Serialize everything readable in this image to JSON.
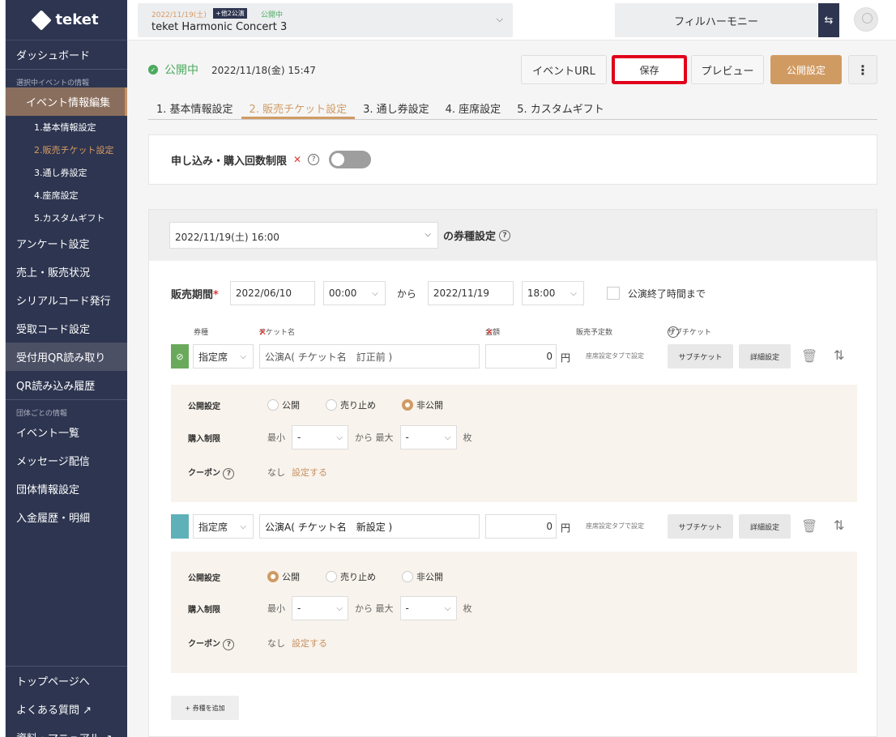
{
  "app": {
    "logo": "teket"
  },
  "sidebar": {
    "dashboard": "ダッシュボード",
    "section_event": "選択中イベントの情報",
    "event_edit": "イベント情報編集",
    "subs": [
      "1.基本情報設定",
      "2.販売チケット設定",
      "3.通し券設定",
      "4.座席設定",
      "5.カスタムギフト"
    ],
    "items": [
      "アンケート設定",
      "売上・販売状況",
      "シリアルコード発行",
      "受取コード設定",
      "受付用QR読み取り",
      "QR読み込み履歴"
    ],
    "section_group": "団体ごとの情報",
    "group_items": [
      "イベント一覧",
      "メッセージ配信",
      "団体情報設定",
      "入金履歴・明細"
    ],
    "bottom_items": [
      "トップページへ",
      "よくある質問 ↗",
      "資料・マニュアル ↗"
    ]
  },
  "topbar": {
    "event_date": "2022/11/19(土)",
    "event_badge": "+他2公演",
    "event_status": "公開中",
    "event_title": "teket Harmonic Concert 3",
    "org": "フィルハーモニー",
    "swap_icon": "⇆"
  },
  "header": {
    "status": "公開中",
    "status_time": "2022/11/18(金) 15:47",
    "btn_url": "イベントURL",
    "btn_save": "保存",
    "btn_preview": "プレビュー",
    "btn_publish": "公開設定",
    "btn_more": "⋮"
  },
  "tabs": [
    "1. 基本情報設定",
    "2. 販売チケット設定",
    "3. 通し券設定",
    "4. 座席設定",
    "5. カスタムギフト"
  ],
  "limit": {
    "label": "申し込み・購入回数制限",
    "enabled": false
  },
  "performance": {
    "selected": "2022/11/19(土) 16:00",
    "suffix": "の券種設定"
  },
  "sales_period": {
    "label": "販売期間",
    "start_date": "2022/06/10",
    "start_time": "00:00",
    "from": "から",
    "end_date": "2022/11/19",
    "end_time": "18:00",
    "until_end": "公演終了時間まで"
  },
  "columns": {
    "type": "券種",
    "name": "チケット名",
    "price": "金額",
    "planned": "販売予定数",
    "sub": "サブチケット"
  },
  "tickets": [
    {
      "color": "#6aa95c",
      "seat": "指定席",
      "name": "公演A( チケット名　訂正前 )",
      "price": "0",
      "yen": "円",
      "planned": "座席設定タブで設定",
      "sub_btn": "サブチケット",
      "detail_btn": "詳細設定",
      "publish_label": "公開設定",
      "publish_options": [
        "公開",
        "売り止め",
        "非公開"
      ],
      "publish_selected": 2,
      "limit_label": "購入制限",
      "min_label": "最小",
      "min_value": "-",
      "to_label": "から 最大",
      "max_value": "-",
      "unit": "枚",
      "coupon_label": "クーポン",
      "coupon_value": "なし",
      "coupon_link": "設定する"
    },
    {
      "color": "#5fb1b9",
      "seat": "指定席",
      "name": "公演A( チケット名　新設定 )",
      "price": "0",
      "yen": "円",
      "planned": "座席設定タブで設定",
      "sub_btn": "サブチケット",
      "detail_btn": "詳細設定",
      "publish_label": "公開設定",
      "publish_options": [
        "公開",
        "売り止め",
        "非公開"
      ],
      "publish_selected": 0,
      "limit_label": "購入制限",
      "min_label": "最小",
      "min_value": "-",
      "to_label": "から 最大",
      "max_value": "-",
      "unit": "枚",
      "coupon_label": "クーポン",
      "coupon_value": "なし",
      "coupon_link": "設定する"
    }
  ],
  "add_ticket": "+ 券種を追加"
}
